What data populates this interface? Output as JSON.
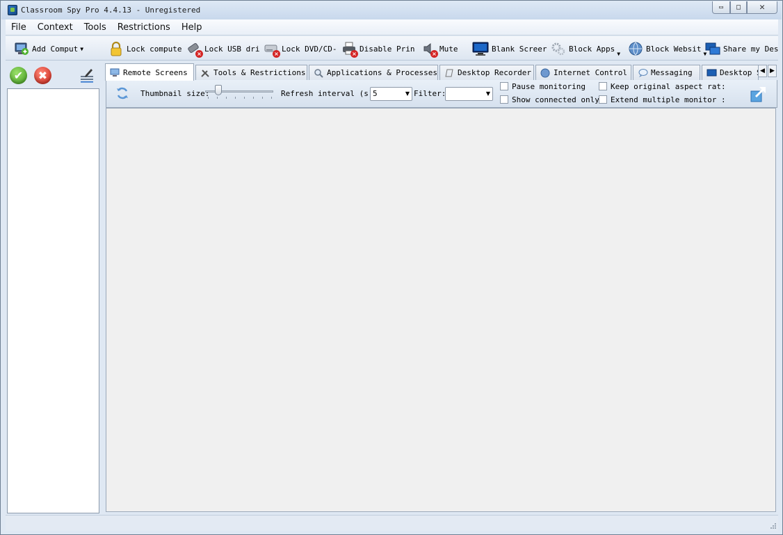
{
  "window": {
    "title": "Classroom Spy Pro 4.4.13 - Unregistered",
    "minimize_glyph": "▭",
    "maximize_glyph": "□",
    "close_glyph": "✕"
  },
  "menu": {
    "items": [
      "File",
      "Context",
      "Tools",
      "Restrictions",
      "Help"
    ]
  },
  "toolbar": {
    "items": [
      {
        "label": "Add Comput",
        "icon": "add-computer-icon",
        "dropdown": true
      },
      {
        "label": "Lock compute",
        "icon": "lock-icon"
      },
      {
        "label": "Lock USB dri",
        "icon": "usb-lock-icon"
      },
      {
        "label": "Lock DVD/CD-",
        "icon": "dvd-lock-icon"
      },
      {
        "label": "Disable Prin",
        "icon": "printer-disable-icon"
      },
      {
        "label": "Mute",
        "icon": "mute-icon"
      },
      {
        "label": "Blank Screer",
        "icon": "monitor-icon"
      },
      {
        "label": "Block Apps",
        "icon": "gears-icon",
        "dropdown": true
      },
      {
        "label": "Block Websit",
        "icon": "globe-icon",
        "dropdown": true
      },
      {
        "label": "Share my Des",
        "icon": "share-desktop-icon"
      }
    ]
  },
  "left_panel": {
    "ok_glyph": "✔",
    "cancel_glyph": "✖"
  },
  "tabs": [
    {
      "label": "Remote Screens",
      "icon": "remote-screens-icon",
      "active": true
    },
    {
      "label": "Tools & Restrictions",
      "icon": "tools-icon"
    },
    {
      "label": "Applications & Processes",
      "icon": "magnifier-icon"
    },
    {
      "label": "Desktop Recorder",
      "icon": "recorder-icon"
    },
    {
      "label": "Internet Control",
      "icon": "internet-icon"
    },
    {
      "label": "Messaging",
      "icon": "message-icon"
    },
    {
      "label": "Desktop S",
      "icon": "desktop-icon"
    }
  ],
  "tab_scroll": {
    "left": "◀",
    "right": "▶"
  },
  "options": {
    "thumbnail_label": "Thumbnail size:",
    "refresh_label": "Refresh interval (s):",
    "refresh_value": "5",
    "filter_label": "Filter:",
    "filter_value": "",
    "dropdown_arrow": "▼",
    "pause_monitoring": "Pause monitoring",
    "show_connected_only": "Show connected only",
    "keep_aspect": "Keep original aspect rat:",
    "extend_monitor": "Extend multiple monitor :"
  },
  "colors": {
    "window_bg": "#dfe8f3",
    "screens_bg": "#f0f0f0",
    "ok_green": "#3e9a1d",
    "cancel_red": "#c81d12",
    "accent_blue": "#1c68c8"
  }
}
